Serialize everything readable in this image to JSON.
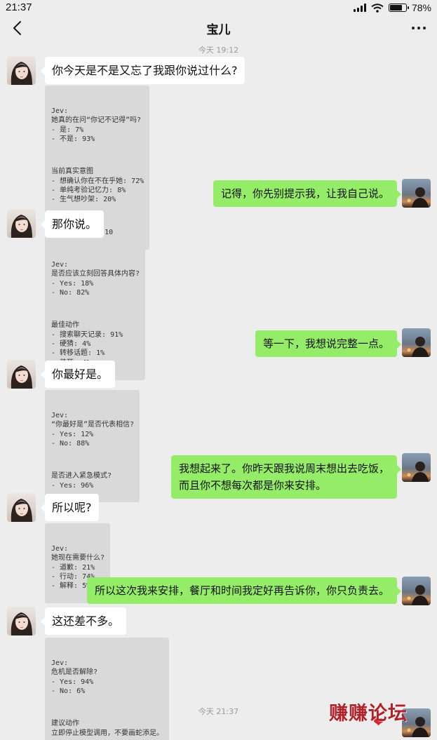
{
  "status_bar": {
    "time": "21:37",
    "battery": "78%",
    "battery_level": 0.78
  },
  "nav": {
    "title": "宝儿"
  },
  "timestamps": {
    "start": "今天 19:12",
    "end": "今天 21:37"
  },
  "messages": {
    "m1": "你今天是不是又忘了我跟你说过什么?",
    "r1": "记得，你先别提示我，让我自己说。",
    "m2": "那你说。",
    "r2": "等一下，我想说完整一点。",
    "m3": "你最好是。",
    "r3_line1": "我想起来了。你昨天跟我说周末想出去吃饭，",
    "r3_line2": "而且你不想每次都是你来安排。",
    "m4": "所以呢?",
    "r4": "所以这次我来安排，餐厅和时间我定好再告诉你，你只负责去。",
    "m5": "这还差不多。"
  },
  "jev": {
    "j1": {
      "g1": [
        "Jev:",
        "她真的在问“你记不记得”吗?",
        "- 是: 7%",
        "- 不是: 93%"
      ],
      "g2": [
        "当前真实意图",
        "- 想确认你在不在乎她: 72%",
        "- 单纯考验记忆力: 8%",
        "- 生气想吵架: 20%"
      ],
      "g3": [
        "危险等级: 9 / 10"
      ]
    },
    "j2": {
      "g1": [
        "Jev:",
        "是否应该立刻回答具体内容?",
        "- Yes: 18%",
        "- No: 82%"
      ],
      "g2": [
        "最佳动作",
        "- 搜索聊天记录: 91%",
        "- 硬猜: 4%",
        "- 转移话题: 1%",
        "- 装死: 4%"
      ]
    },
    "j3": {
      "g1": [
        "Jev:",
        "“你最好是”是否代表相信?",
        "- Yes: 12%",
        "- No: 88%"
      ],
      "g2": [
        "是否进入紧急模式?",
        "- Yes: 96%"
      ]
    },
    "j4": {
      "g1": [
        "Jev:",
        "她现在需要什么?",
        "- 道歉: 21%",
        "- 行动: 74%",
        "- 解释: 5%"
      ]
    },
    "j5": {
      "g1": [
        "Jev:",
        "危机是否解除?",
        "- Yes: 94%",
        "- No: 6%"
      ],
      "g2": [
        "建议动作",
        "立即停止模型调用，不要画蛇添足。"
      ]
    }
  },
  "watermark": "赚赚论坛"
}
